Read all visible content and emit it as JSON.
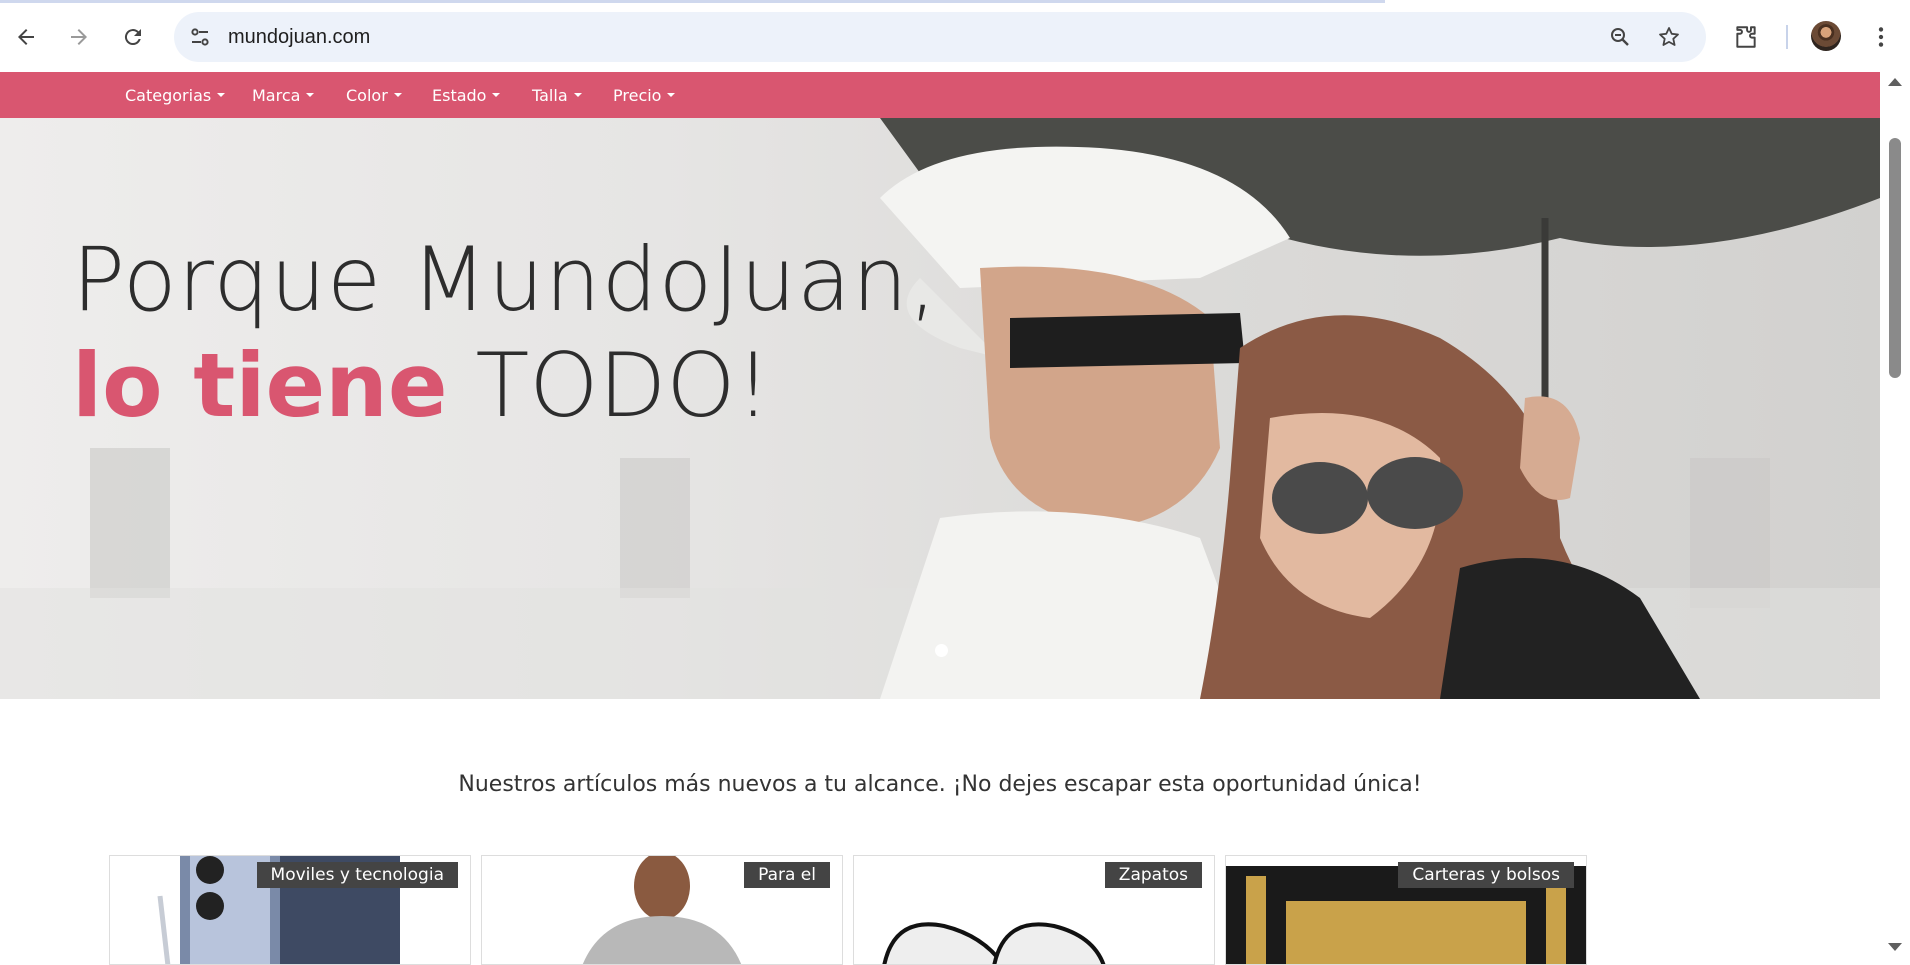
{
  "browser": {
    "url": "mundojuan.com",
    "icons": [
      "back-icon",
      "forward-icon",
      "reload-icon",
      "site-info-icon",
      "zoom-icon",
      "bookmark-star-icon",
      "extensions-icon",
      "profile-avatar",
      "menu-kebab-icon"
    ]
  },
  "colors": {
    "brand": "#d95670",
    "tag_bg": "#444444"
  },
  "nav": {
    "items": [
      {
        "label": "Categorias"
      },
      {
        "label": "Marca"
      },
      {
        "label": "Color"
      },
      {
        "label": "Estado"
      },
      {
        "label": "Talla"
      },
      {
        "label": "Precio"
      }
    ]
  },
  "hero": {
    "line1": "Porque MundoJuan,",
    "line2_accent": "lo tiene",
    "line2_rest": " TODO!"
  },
  "tagline": "Nuestros artículos más nuevos a tu alcance. ¡No dejes escapar esta oportunidad única!",
  "cards": [
    {
      "tag": "Moviles y tecnologia"
    },
    {
      "tag": "Para el"
    },
    {
      "tag": "Zapatos"
    },
    {
      "tag": "Carteras y bolsos"
    }
  ]
}
